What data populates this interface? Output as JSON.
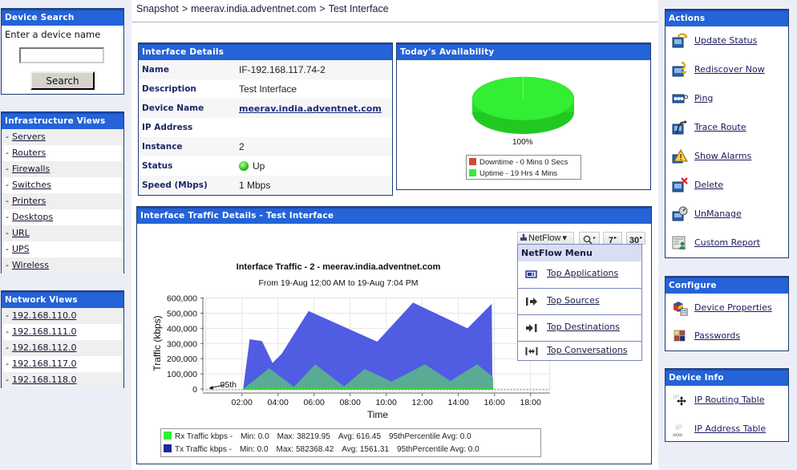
{
  "left": {
    "device_search": {
      "title": "Device Search",
      "prompt": "Enter a device name",
      "input_value": "",
      "button": "Search"
    },
    "infrastructure_views": {
      "title": "Infrastructure Views",
      "bullet": "-",
      "items": [
        "Servers",
        "Routers",
        "Firewalls",
        "Switches",
        "Printers",
        "Desktops",
        "URL",
        "UPS",
        "Wireless"
      ]
    },
    "network_views": {
      "title": "Network Views",
      "bullet": "-",
      "items": [
        "192.168.110.0",
        "192.168.111.0",
        "192.168.112.0",
        "192.168.117.0",
        "192.168.118.0"
      ]
    }
  },
  "breadcrumb": {
    "separator": ">",
    "items": [
      "Snapshot",
      "meerav.india.adventnet.com",
      "Test Interface"
    ]
  },
  "interface_details": {
    "title": "Interface Details",
    "rows": [
      {
        "label": "Name",
        "value": "IF-192.168.117.74-2"
      },
      {
        "label": "Description",
        "value": "Test Interface"
      },
      {
        "label": "Device Name",
        "value": "meerav.india.adventnet.com"
      },
      {
        "label": "IP Address",
        "value": ""
      },
      {
        "label": "Instance",
        "value": "2"
      },
      {
        "label": "Status",
        "value": "Up",
        "status_color": "#33cc22"
      },
      {
        "label": "Speed (Mbps)",
        "value": "1 Mbps"
      }
    ]
  },
  "availability": {
    "title": "Today's Availability",
    "percent_label": "100%",
    "legend": [
      {
        "label": "Downtime - 0 Mins 0 Secs",
        "color": "#d04a3a"
      },
      {
        "label": "Uptime - 19 Hrs 4 Mins",
        "color": "#33ee33"
      }
    ]
  },
  "traffic": {
    "title": "Interface Traffic Details - Test Interface",
    "toolbar": {
      "netflow": "NetFlow",
      "netflow_caret": "▾",
      "zoom_tri": "▸",
      "seven": "7",
      "thirty": "30"
    },
    "netflow_menu": {
      "title": "NetFlow Menu",
      "items": [
        "Top Applications",
        "Top Sources",
        "Top Destinations",
        "Top Conversations"
      ]
    },
    "legend": [
      {
        "name": "Rx Traffic kbps -",
        "min": "Min:  0.0",
        "max": "Max:  38219.95",
        "avg": "Avg:  616.45",
        "p95": "95thPercentile Avg: 0.0",
        "color": "#33ee33"
      },
      {
        "name": "Tx Traffic kbps -",
        "min": "Min:  0.0",
        "max": "Max:  582368.42",
        "avg": "Avg:  1561.31",
        "p95": "95thPercentile Avg: 0.0",
        "color": "#1a2a9a"
      }
    ]
  },
  "right": {
    "actions": {
      "title": "Actions",
      "items": [
        "Update Status",
        "Rediscover Now",
        "Ping",
        "Trace Route",
        "Show Alarms",
        "Delete",
        "UnManage",
        "Custom Report"
      ]
    },
    "configure": {
      "title": "Configure",
      "items": [
        "Device Properties",
        "Passwords"
      ]
    },
    "device_info": {
      "title": "Device Info",
      "items": [
        "IP Routing Table",
        "IP Address Table"
      ]
    }
  },
  "colors": {
    "header_blue": "#2463d8",
    "panel_border": "#1d3c72",
    "tx_area": "#505ce2",
    "rx_area": "#5aab94"
  },
  "chart_data": [
    {
      "type": "area",
      "title": "Interface Traffic - 2  - meerav.india.adventnet.com",
      "subtitle": "From  19-Aug 12:00 AM to 19-Aug 7:04 PM",
      "xlabel": "Time",
      "ylabel": "Traffic (kbps)",
      "xlim": [
        "00:00",
        "19:04"
      ],
      "ylim": [
        0,
        600000
      ],
      "xticks": [
        "02:00",
        "04:00",
        "06:00",
        "08:00",
        "10:00",
        "12:00",
        "14:00",
        "16:00",
        "18:00"
      ],
      "yticks": [
        0,
        100000,
        200000,
        300000,
        400000,
        500000,
        600000
      ],
      "ytick_labels": [
        "0",
        "100,000",
        "200,000",
        "300,000",
        "400,000",
        "500,000",
        "600,000"
      ],
      "grid": true,
      "series": [
        {
          "name": "Tx Traffic kbps",
          "color": "#505ce2",
          "points": [
            [
              "02:04",
              0
            ],
            [
              "02:26",
              328000
            ],
            [
              "03:07",
              316000
            ],
            [
              "03:42",
              172000
            ],
            [
              "04:12",
              232000
            ],
            [
              "05:42",
              515000
            ],
            [
              "09:30",
              312000
            ],
            [
              "11:29",
              570000
            ],
            [
              "14:30",
              400000
            ],
            [
              "15:51",
              562000
            ],
            [
              "15:53",
              0
            ]
          ]
        },
        {
          "name": "Rx Traffic kbps",
          "color": "#5aab94",
          "points": [
            [
              "02:04",
              0
            ],
            [
              "03:31",
              137000
            ],
            [
              "04:53",
              14000
            ],
            [
              "06:04",
              163000
            ],
            [
              "07:40",
              17000
            ],
            [
              "08:48",
              132000
            ],
            [
              "10:18",
              49000
            ],
            [
              "12:09",
              163000
            ],
            [
              "13:33",
              53000
            ],
            [
              "15:02",
              163000
            ],
            [
              "15:55",
              79000
            ],
            [
              "15:56",
              0
            ]
          ]
        }
      ],
      "baseline_line": {
        "from": "02:04",
        "to": "15:56",
        "value": 0,
        "color": "#33dd33"
      },
      "percentile_line": {
        "value": 0,
        "style": "dashed"
      },
      "annotations": [
        {
          "text": "95th",
          "x": "00:53",
          "y": 0
        }
      ],
      "legend": "bottom"
    },
    {
      "type": "pie",
      "title": "Today's Availability",
      "slices": [
        {
          "label": "Downtime - 0 Mins 0 Secs",
          "value": 0,
          "color": "#d04a3a"
        },
        {
          "label": "Uptime - 19 Hrs 4 Mins",
          "value": 100,
          "color": "#33ee33"
        }
      ],
      "slice_label": "100%",
      "legend": "bottom"
    }
  ]
}
